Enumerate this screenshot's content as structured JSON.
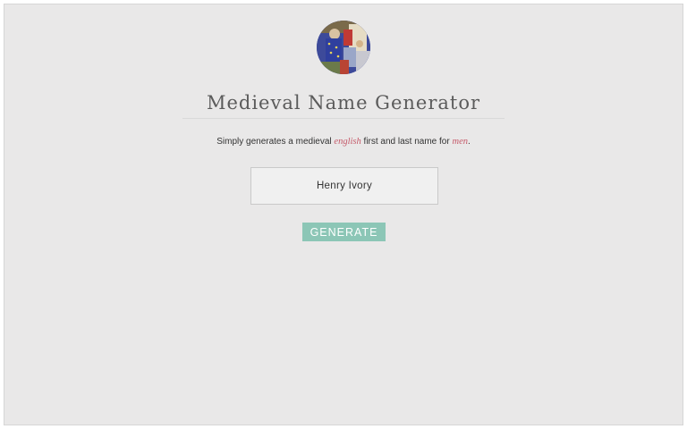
{
  "page": {
    "title": "Medieval Name Generator",
    "avatar_icon": "medieval-illumination-portrait"
  },
  "description": {
    "prefix": "Simply generates a medieval ",
    "language": "english",
    "middle": " first and last name for ",
    "gender": "men",
    "suffix": "."
  },
  "result": {
    "name": "Henry Ivory"
  },
  "actions": {
    "generate_label": "GENERATE"
  },
  "colors": {
    "background": "#e9e8e8",
    "accent_button": "#8cc6b6",
    "highlight_text": "#c55a6a",
    "title_text": "#5b5b5b"
  }
}
